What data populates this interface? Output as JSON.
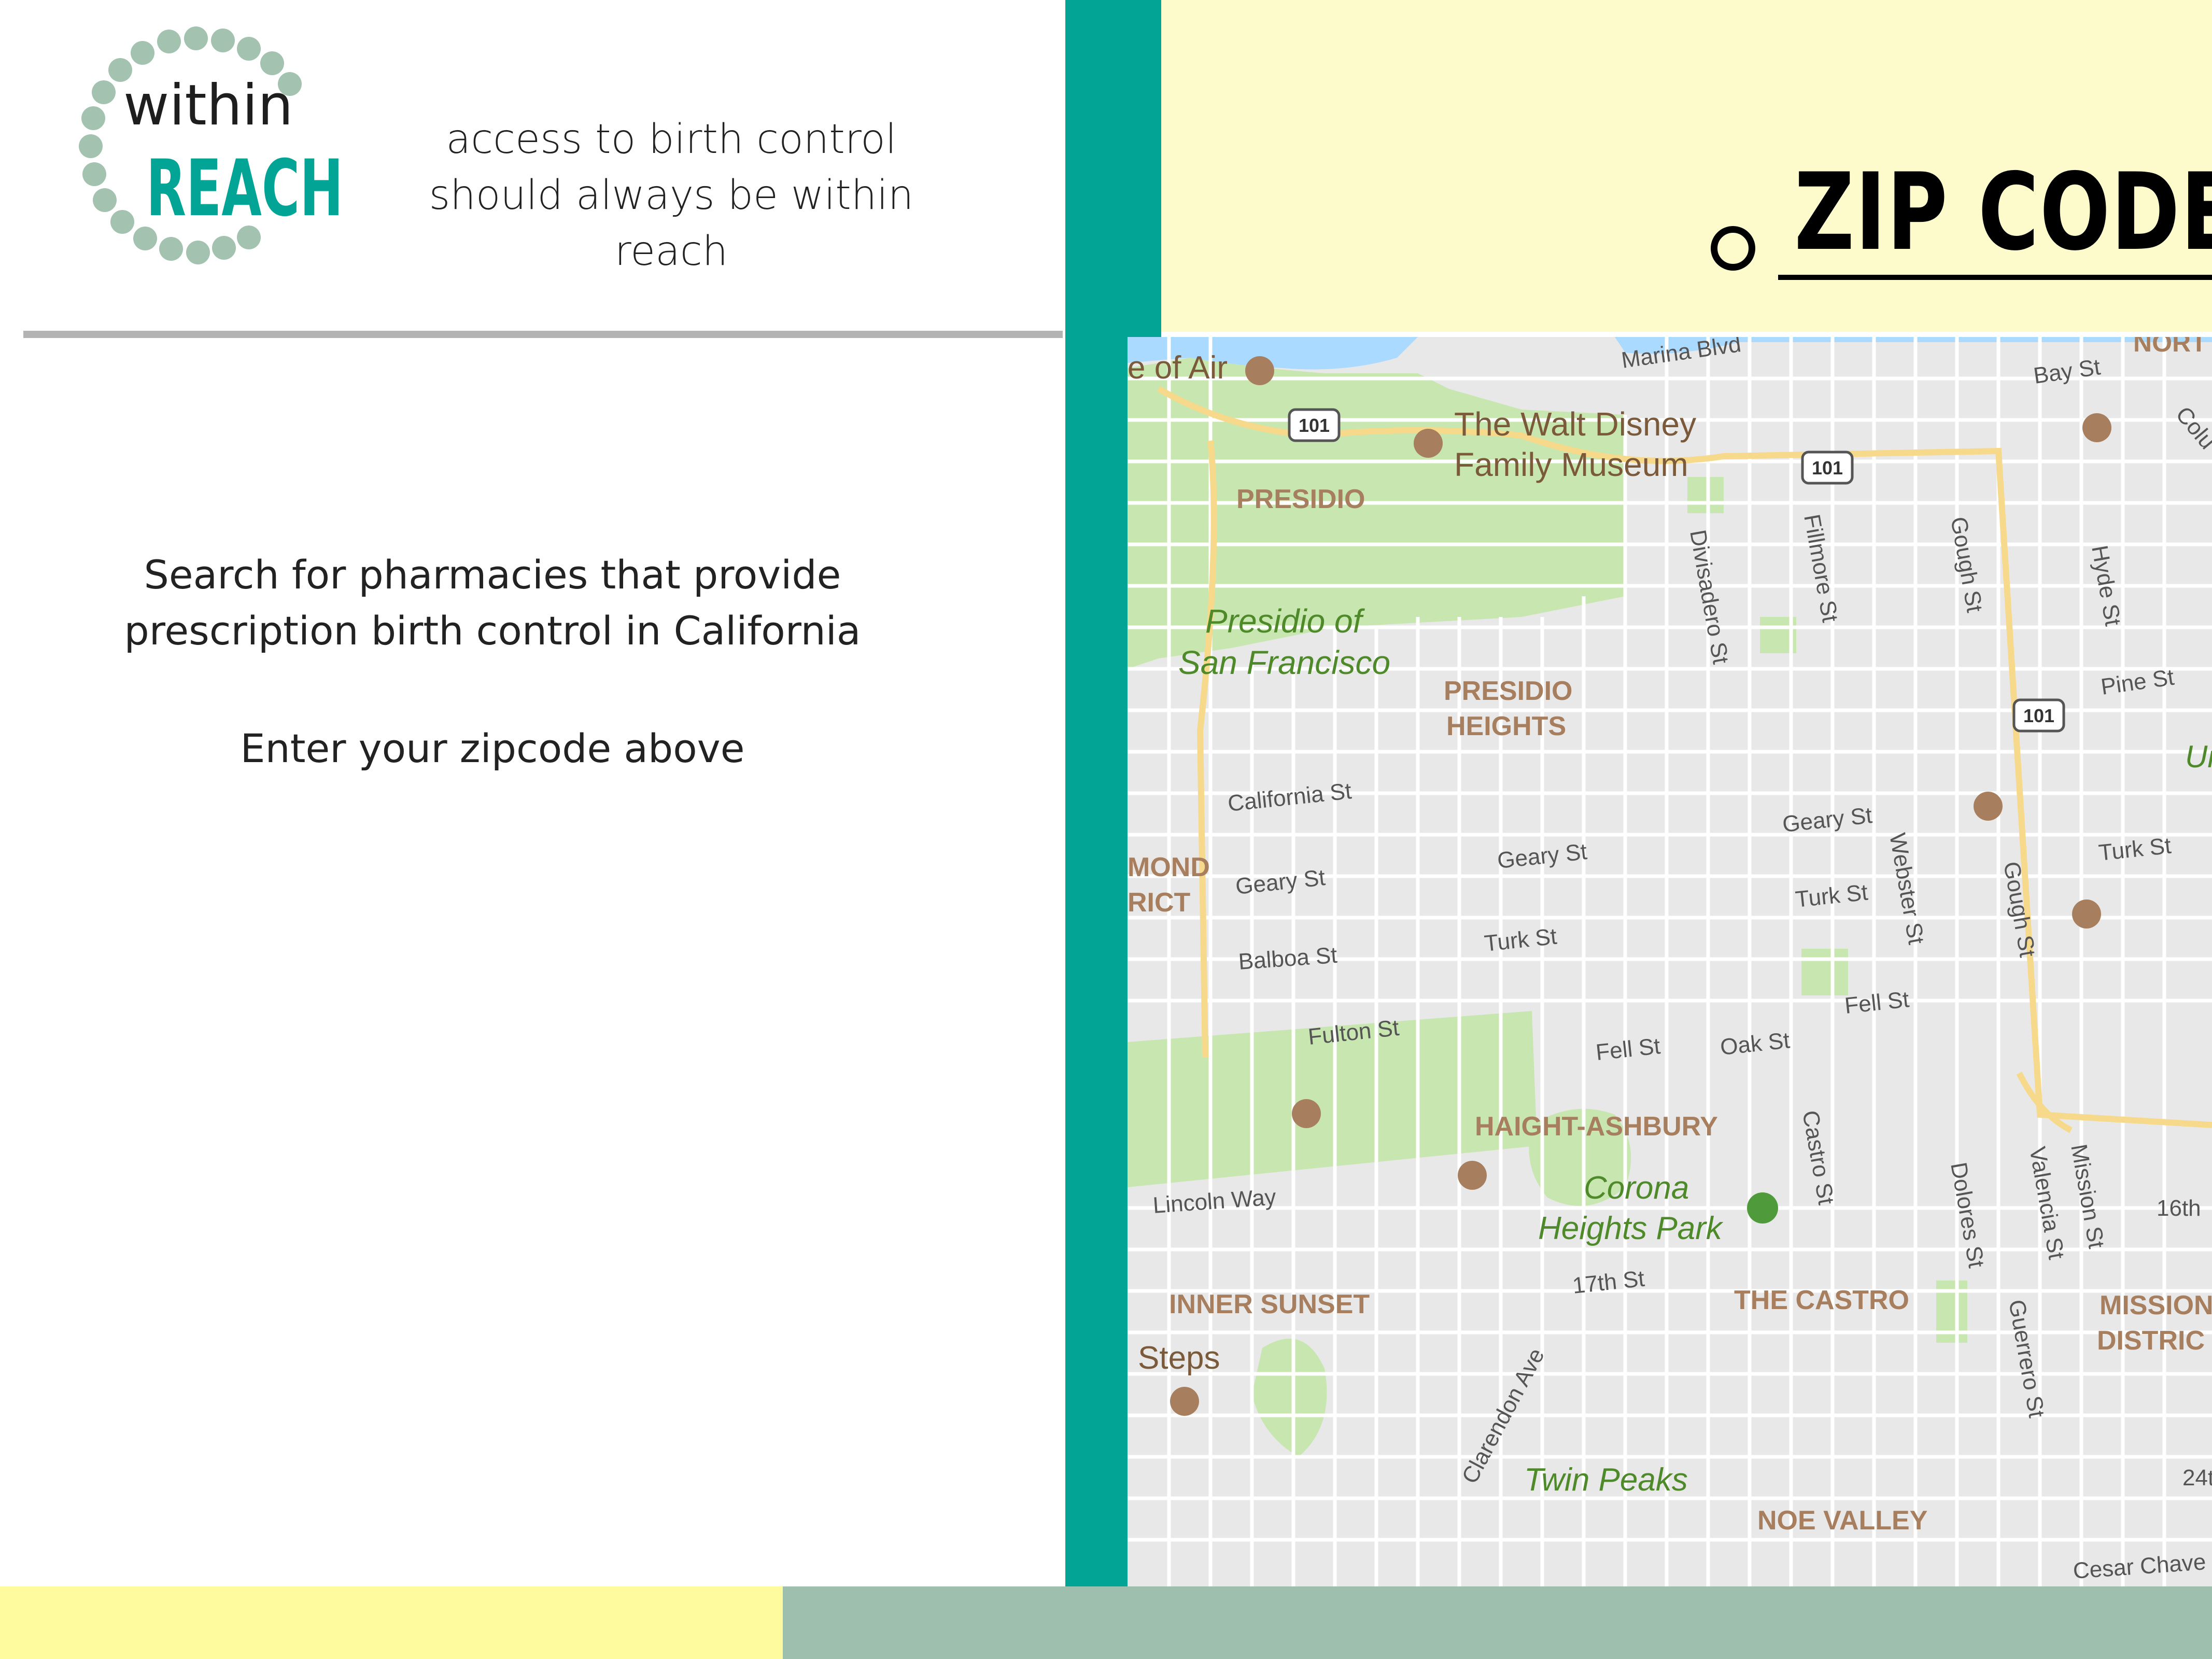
{
  "brand": {
    "logo_word_1": "within",
    "logo_word_2": "REACH",
    "colors": {
      "teal": "#02a495",
      "dot_green": "#a3c2b0",
      "yellow": "#fdfbcb",
      "footer_yellow": "#fdfb9d",
      "footer_green": "#9fbfae"
    }
  },
  "header": {
    "tagline_line_1": "access to birth control",
    "tagline_line_2": "should always be within reach"
  },
  "search": {
    "zip_placeholder": "ZIP CODE"
  },
  "main": {
    "search_line_1": "Search for pharmacies that provide",
    "search_line_2": "prescription birth control in California",
    "instruction": "Enter your zipcode above"
  },
  "map": {
    "places": {
      "palace_partial": "e of Air",
      "marina": "Marina Blvd",
      "north_partial": "NORT",
      "bay_st": "Bay St",
      "colu_partial": "Colu",
      "disney_1": "The Walt Disney",
      "disney_2": "Family Museum",
      "presidio": "PRESIDIO",
      "presidio_sf_1": "Presidio of",
      "presidio_sf_2": "San Francisco",
      "presidio_heights_1": "PRESIDIO",
      "presidio_heights_2": "HEIGHTS",
      "divisadero": "Divisadero St",
      "fillmore": "Fillmore St",
      "gough_1": "Gough St",
      "hyde": "Hyde St",
      "pine": "Pine St",
      "un_partial": "Ur",
      "california": "California St",
      "geary_1": "Geary St",
      "geary_2": "Geary St",
      "geary_3": "Geary St",
      "turk_1": "Turk St",
      "turk_2": "Turk St",
      "turk_3": "Turk St",
      "webster": "Webster St",
      "gough_2": "Gough St",
      "richmond_1": "MOND",
      "richmond_2": "RICT",
      "balboa": "Balboa St",
      "fulton": "Fulton St",
      "fell_1": "Fell St",
      "fell_2": "Fell St",
      "oak": "Oak St",
      "haight": "HAIGHT-ASHBURY",
      "corona_1": "Corona",
      "corona_2": "Heights Park",
      "castro_st": "Castro St",
      "dolores": "Dolores St",
      "valencia": "Valencia St",
      "mission_st": "Mission St",
      "sixteenth": "16th",
      "lincoln": "Lincoln Way",
      "seventeenth": "17th St",
      "inner_sunset": "INNER SUNSET",
      "the_castro": "THE CASTRO",
      "mission_1": "MISSION",
      "mission_2": "DISTRIC",
      "steps": "Steps",
      "clarendon": "Clarendon Ave",
      "guerrero": "Guerrero St",
      "twin_peaks": "Twin Peaks",
      "noe_valley": "NOE VALLEY",
      "twentyfourth": "24t",
      "cesar": "Cesar Chave",
      "hwy": "101"
    }
  }
}
